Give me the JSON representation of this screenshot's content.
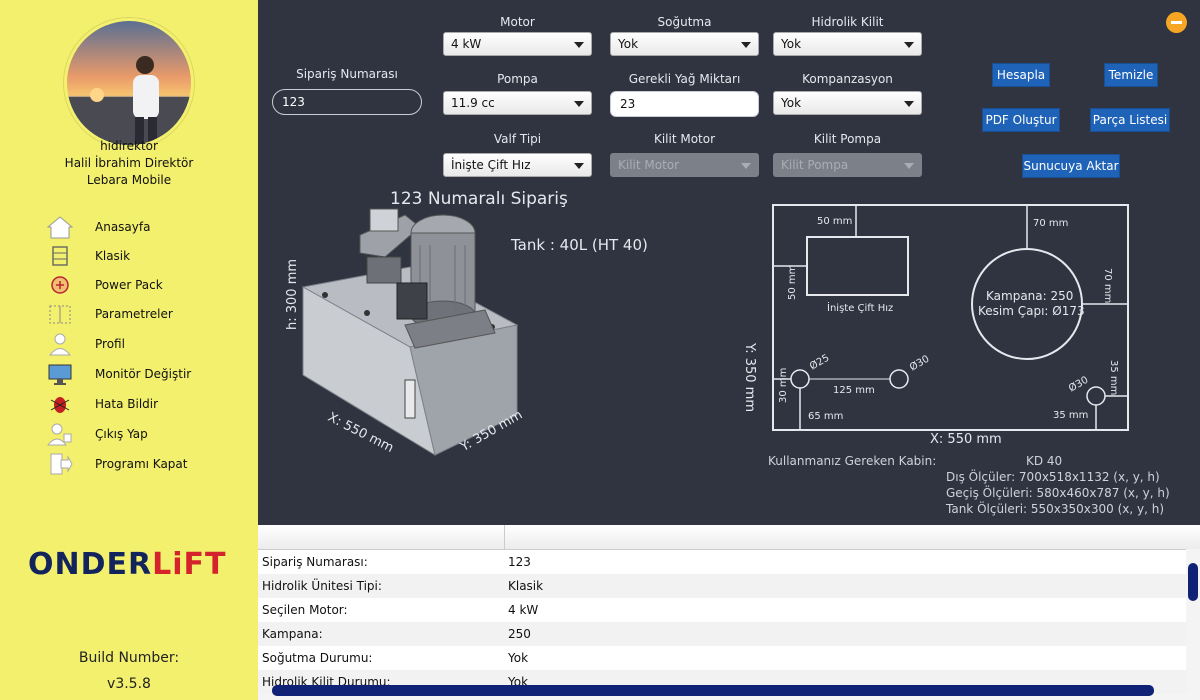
{
  "sidebar": {
    "username": "hidirektor",
    "fullname": "Halil İbrahim Direktör",
    "company": "Lebara Mobile",
    "nav": [
      {
        "label": "Anasayfa",
        "icon": "home-icon"
      },
      {
        "label": "Klasik",
        "icon": "klasik-icon"
      },
      {
        "label": "Power Pack",
        "icon": "power-pack-icon"
      },
      {
        "label": "Parametreler",
        "icon": "parameters-icon"
      },
      {
        "label": "Profil",
        "icon": "profile-icon"
      },
      {
        "label": "Monitör Değiştir",
        "icon": "monitor-icon"
      },
      {
        "label": "Hata Bildir",
        "icon": "bug-icon"
      },
      {
        "label": "Çıkış Yap",
        "icon": "logout-user-icon"
      },
      {
        "label": "Programı Kapat",
        "icon": "exit-icon"
      }
    ],
    "logo_text": "ONDERLIFT",
    "build_label": "Build Number:",
    "build_number": "v3.5.8"
  },
  "form": {
    "siparis_label": "Sipariş Numarası",
    "siparis_value": "123",
    "motor_label": "Motor",
    "motor_value": "4 kW",
    "sogutma_label": "Soğutma",
    "sogutma_value": "Yok",
    "hidrolik_label": "Hidrolik Kilit",
    "hidrolik_value": "Yok",
    "pompa_label": "Pompa",
    "pompa_value": "11.9 cc",
    "yag_label": "Gerekli Yağ Miktarı",
    "yag_value": "23",
    "kompanzasyon_label": "Kompanzasyon",
    "kompanzasyon_value": "Yok",
    "valf_label": "Valf Tipi",
    "valf_value": "İnişte Çift Hız",
    "kilit_motor_label": "Kilit Motor",
    "kilit_motor_placeholder": "Kilit Motor",
    "kilit_pompa_label": "Kilit Pompa",
    "kilit_pompa_placeholder": "Kilit Pompa"
  },
  "buttons": {
    "hesapla": "Hesapla",
    "temizle": "Temizle",
    "pdf": "PDF Oluştur",
    "parca": "Parça Listesi",
    "sunucu": "Sunucuya Aktar"
  },
  "visual": {
    "order_title": "123 Numaralı Sipariş",
    "tank_label": "Tank : 40L (HT 40)",
    "h_label": "h: 300 mm",
    "x_label": "X: 550 mm",
    "y_label": "Y: 350 mm"
  },
  "diagram": {
    "y_axis": "Y: 350 mm",
    "x_axis": "X: 550 mm",
    "d_50_top": "50 mm",
    "d_50_side": "50 mm",
    "d_70_top": "70 mm",
    "d_70_side": "70 mm",
    "valve_label": "İnişte Çift Hız",
    "kampana": "Kampana: 250",
    "kesim": "Kesim Çapı: Ø173",
    "d_25": "Ø25",
    "d_30_a": "Ø30",
    "d_30_b": "Ø30",
    "d_125": "125 mm",
    "d_30_side": "30 mm",
    "d_65": "65 mm",
    "d_35_side": "35 mm",
    "d_35_bottom": "35 mm"
  },
  "kabin": {
    "label": "Kullanmanız Gereken Kabin:",
    "name": "KD 40",
    "dis": "Dış Ölçüler: 700x518x1132 (x, y, h)",
    "gecis": "Geçiş Ölçüleri: 580x460x787 (x, y, h)",
    "tank": "Tank Ölçüleri: 550x350x300 (x, y, h)"
  },
  "table": {
    "rows": [
      {
        "key": "Sipariş Numarası:",
        "value": "123"
      },
      {
        "key": "Hidrolik Ünitesi Tipi:",
        "value": "Klasik"
      },
      {
        "key": "Seçilen Motor:",
        "value": "4 kW"
      },
      {
        "key": "Kampana:",
        "value": "250"
      },
      {
        "key": "Soğutma Durumu:",
        "value": "Yok"
      },
      {
        "key": "Hidrolik Kilit Durumu:",
        "value": "Yok"
      }
    ]
  },
  "colors": {
    "sidebar_bg": "#f3f06e",
    "main_bg": "#2f3440",
    "button_blue": "#1f63b8",
    "accent_orange": "#f6a623",
    "scroll_thumb": "#0f2275",
    "logo_red": "#d4232a",
    "logo_navy": "#13245c"
  }
}
